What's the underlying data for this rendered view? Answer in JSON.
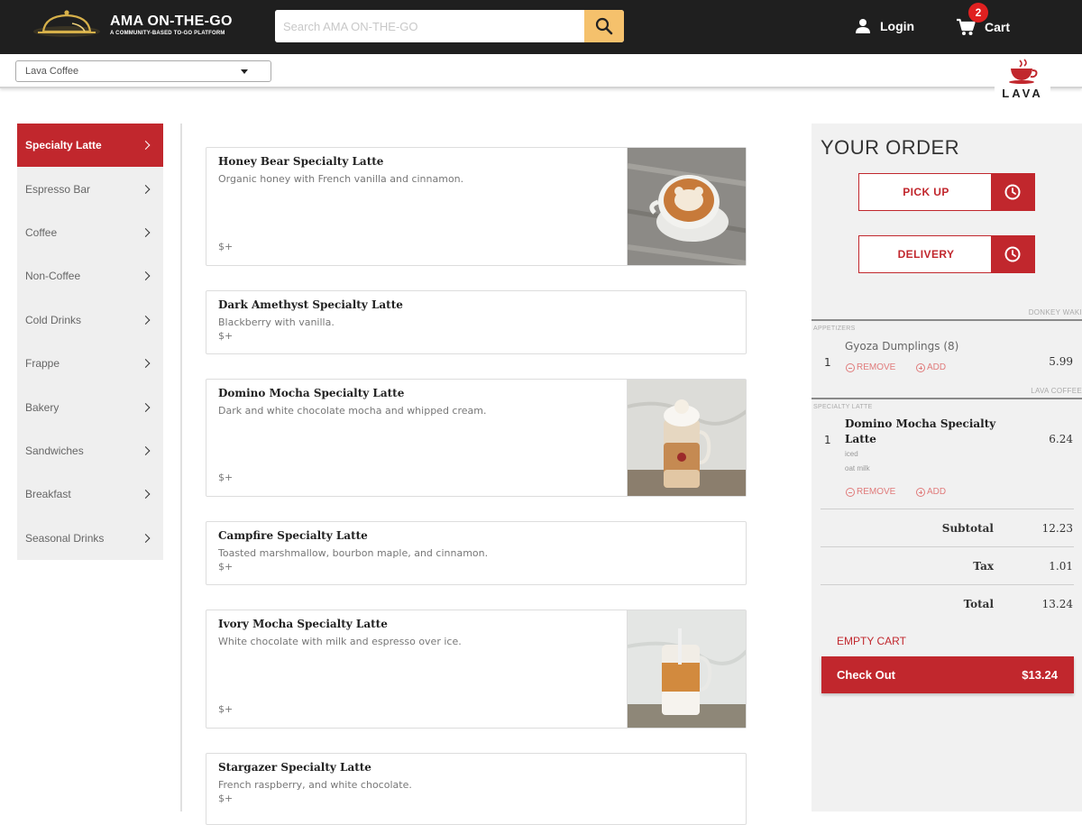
{
  "header": {
    "brand_name": "AMA ON-THE-GO",
    "brand_tagline": "A COMMUNITY-BASED TO-GO PLATFORM",
    "search_placeholder": "Search AMA ON-THE-GO",
    "login_label": "Login",
    "cart_label": "Cart",
    "cart_count": "2"
  },
  "storebar": {
    "selected_store": "Lava Coffee",
    "store_logo_text": "LAVA"
  },
  "categories": [
    {
      "label": "Specialty Latte",
      "active": true
    },
    {
      "label": "Espresso Bar"
    },
    {
      "label": "Coffee"
    },
    {
      "label": "Non-Coffee"
    },
    {
      "label": "Cold Drinks"
    },
    {
      "label": "Frappe"
    },
    {
      "label": "Bakery"
    },
    {
      "label": "Sandwiches"
    },
    {
      "label": "Breakfast"
    },
    {
      "label": "Seasonal Drinks"
    }
  ],
  "menu_items": [
    {
      "title": "Honey Bear Specialty Latte",
      "desc": "Organic honey with French vanilla and cinnamon.",
      "price": "$+",
      "image": "latte-art-photo"
    },
    {
      "title": "Dark Amethyst Specialty Latte",
      "desc": "Blackberry with vanilla.",
      "price": "$+"
    },
    {
      "title": "Domino Mocha Specialty Latte",
      "desc": "Dark and white chocolate mocha and whipped cream.",
      "price": "$+",
      "image": "mason-jar-mocha-photo"
    },
    {
      "title": "Campfire Specialty Latte",
      "desc": "Toasted marshmallow, bourbon maple, and cinnamon.",
      "price": "$+"
    },
    {
      "title": "Ivory Mocha Specialty Latte",
      "desc": "White chocolate with milk and espresso over ice.",
      "price": "$+",
      "image": "iced-mocha-photo"
    },
    {
      "title": "Stargazer Specialty Latte",
      "desc": "French raspberry, and white chocolate.",
      "price": "$+"
    }
  ],
  "order": {
    "title": "YOUR ORDER",
    "pickup_label": "PICK UP",
    "delivery_label": "DELIVERY",
    "groups": [
      {
        "vendor": "DONKEY WAKI",
        "section": "APPETIZERS",
        "qty": "1",
        "name": "Gyoza Dumplings (8)",
        "mods": [],
        "price": "5.99",
        "remove_label": "REMOVE",
        "add_label": "ADD"
      },
      {
        "vendor": "LAVA COFFEE",
        "section": "SPECIALTY LATTE",
        "qty": "1",
        "name": "Domino Mocha Specialty Latte",
        "mods": [
          "iced",
          "oat milk"
        ],
        "price": "6.24",
        "remove_label": "REMOVE",
        "add_label": "ADD"
      }
    ],
    "subtotal_label": "Subtotal",
    "subtotal": "12.23",
    "tax_label": "Tax",
    "tax": "1.01",
    "total_label": "Total",
    "total": "13.24",
    "empty_label": "EMPTY CART",
    "checkout_label": "Check Out",
    "checkout_amount": "$13.24"
  },
  "colors": {
    "header_bg": "#1f1f1f",
    "accent_red": "#c1272d",
    "search_button": "#f5c16c",
    "panel_bg": "#f1f1f1"
  }
}
